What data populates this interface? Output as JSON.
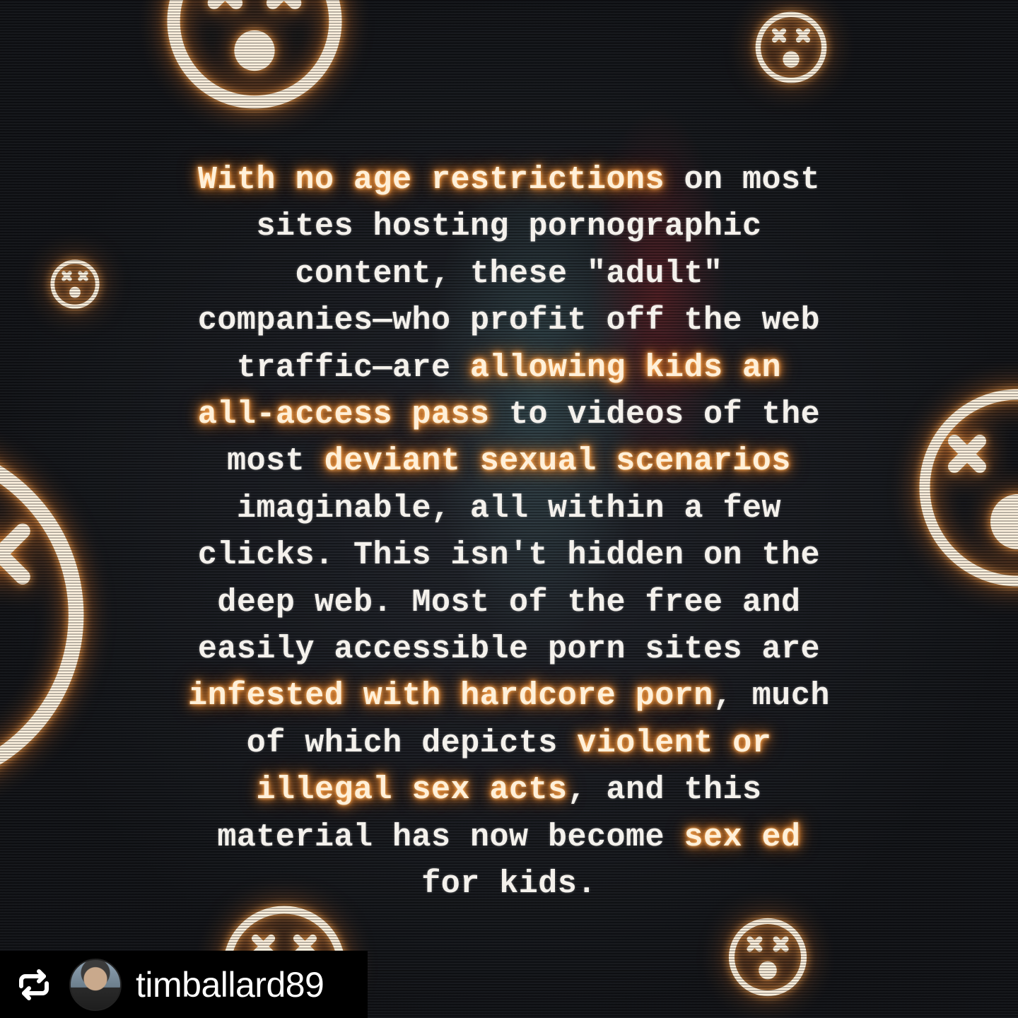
{
  "post": {
    "lines": [
      [
        {
          "t": "With no age restrictions",
          "hl": true
        },
        {
          "t": " on most",
          "hl": false
        }
      ],
      [
        {
          "t": "sites hosting pornographic",
          "hl": false
        }
      ],
      [
        {
          "t": "content, these \"adult\"",
          "hl": false
        }
      ],
      [
        {
          "t": "companies—who profit off the web",
          "hl": false
        }
      ],
      [
        {
          "t": "traffic—are ",
          "hl": false
        },
        {
          "t": "allowing kids an",
          "hl": true
        }
      ],
      [
        {
          "t": "all-access pass",
          "hl": true
        },
        {
          "t": " to videos of the",
          "hl": false
        }
      ],
      [
        {
          "t": "most ",
          "hl": false
        },
        {
          "t": "deviant sexual scenarios",
          "hl": true
        }
      ],
      [
        {
          "t": "imaginable, all within a few",
          "hl": false
        }
      ],
      [
        {
          "t": "clicks. This isn't hidden on the",
          "hl": false
        }
      ],
      [
        {
          "t": "deep web. Most of the free and",
          "hl": false
        }
      ],
      [
        {
          "t": "easily accessible porn sites are",
          "hl": false
        }
      ],
      [
        {
          "t": "infested with hardcore porn",
          "hl": true
        },
        {
          "t": ", much",
          "hl": false
        }
      ],
      [
        {
          "t": "of which depicts ",
          "hl": false
        },
        {
          "t": "violent or",
          "hl": true
        }
      ],
      [
        {
          "t": "illegal sex acts",
          "hl": true
        },
        {
          "t": ", and this",
          "hl": false
        }
      ],
      [
        {
          "t": "material has now become ",
          "hl": false
        },
        {
          "t": "sex ed",
          "hl": true
        }
      ],
      [
        {
          "t": "for kids.",
          "hl": false
        }
      ]
    ]
  },
  "repost": {
    "icon": "repost-icon",
    "username": "timballard89"
  },
  "decor": {
    "icon": "dizzy-face-icon",
    "glow_color": "#ff9a3c",
    "background_color": "#15171c"
  }
}
